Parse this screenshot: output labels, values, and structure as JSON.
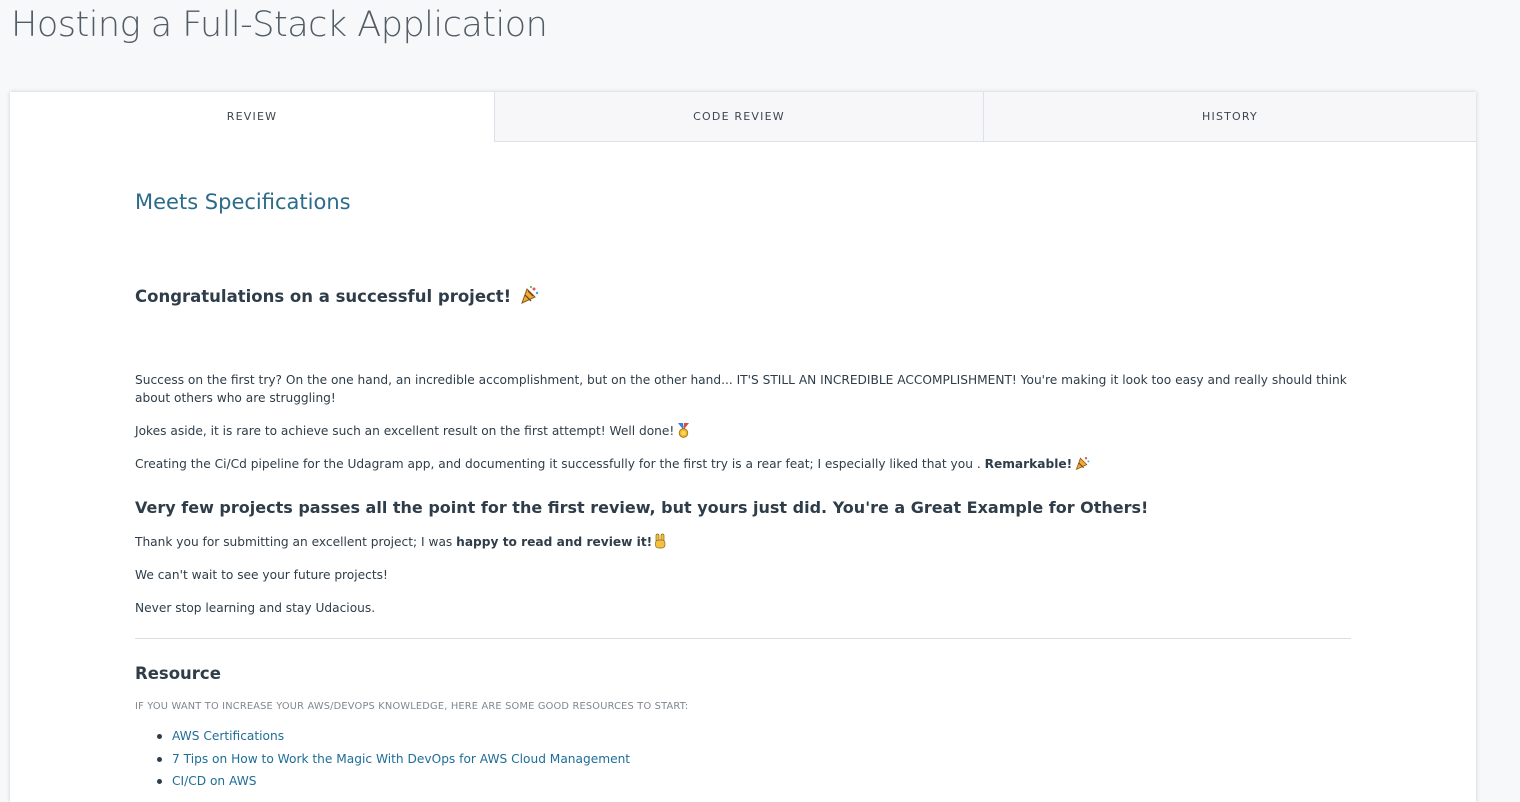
{
  "page": {
    "title": "Hosting a Full-Stack Application"
  },
  "tabs": [
    {
      "label": "REVIEW",
      "active": true
    },
    {
      "label": "CODE REVIEW",
      "active": false
    },
    {
      "label": "HISTORY",
      "active": false
    }
  ],
  "review": {
    "status": "Meets Specifications",
    "congrats_heading": "Congratulations on a successful project!",
    "p1": "Success on the first try? On the one hand, an incredible accomplishment, but on the other hand... IT'S STILL AN INCREDIBLE ACCOMPLISHMENT! You're making it look too easy and really should think about others who are struggling!",
    "p2": "Jokes aside, it is rare to achieve such an excellent result on the first attempt! Well done!",
    "p3_text": "Creating the Ci/Cd pipeline for the Udagram app, and documenting it successfully for the first try is a rear feat; I especially liked that you .",
    "p3_bold": "Remarkable!",
    "few_heading": "Very few projects passes all the point for the first review, but yours just did. You're a Great Example for Others!",
    "p5_text": "Thank you for submitting an excellent project; I was",
    "p5_bold": "happy to read and review it!",
    "p6": "We can't wait to see your future projects!",
    "p7": "Never stop learning and stay Udacious."
  },
  "resources": {
    "heading": "Resource",
    "intro": "IF YOU WANT TO INCREASE YOUR AWS/DEVOPS KNOWLEDGE, HERE ARE SOME GOOD RESOURCES TO START:",
    "links": [
      {
        "label": "AWS Certifications"
      },
      {
        "label": "7 Tips on How to Work the Magic With DevOps for AWS Cloud Management"
      },
      {
        "label": "CI/CD on AWS"
      }
    ]
  },
  "icons": {
    "congrats": "party-popper-icon",
    "well_done": "medal-icon",
    "remarkable": "party-popper-icon",
    "happy": "victory-hand-icon"
  },
  "colors": {
    "heading_blue": "#2d6b8a",
    "link_blue": "#1e6d98",
    "text": "#2e3d49",
    "muted": "#7d8790"
  }
}
